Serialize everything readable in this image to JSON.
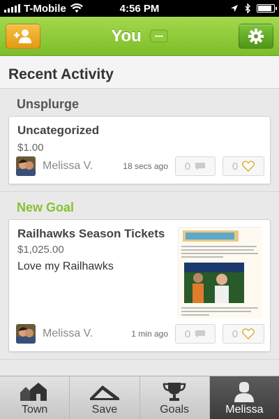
{
  "status_bar": {
    "carrier": "T-Mobile",
    "time": "4:56 PM"
  },
  "nav": {
    "title": "You"
  },
  "page_header": "Recent Activity",
  "sections": [
    {
      "title": "Unsplurge",
      "card": {
        "category": "Uncategorized",
        "amount": "$1.00",
        "user": "Melissa V.",
        "time_ago": "18 secs ago",
        "comments": "0",
        "likes": "0"
      }
    },
    {
      "title": "New Goal",
      "card": {
        "category": "Railhawks Season Tickets",
        "amount": "$1,025.00",
        "note": "Love my Railhawks",
        "user": "Melissa V.",
        "time_ago": "1 min ago",
        "comments": "0",
        "likes": "0"
      }
    }
  ],
  "tabs": [
    {
      "label": "Town",
      "icon": "town-icon"
    },
    {
      "label": "Save",
      "icon": "save-icon"
    },
    {
      "label": "Goals",
      "icon": "trophy-icon"
    },
    {
      "label": "Melissa",
      "icon": "person-icon",
      "active": true
    }
  ],
  "colors": {
    "green": "#7cbd28",
    "orange": "#e39a12",
    "section_green": "#87c133"
  }
}
